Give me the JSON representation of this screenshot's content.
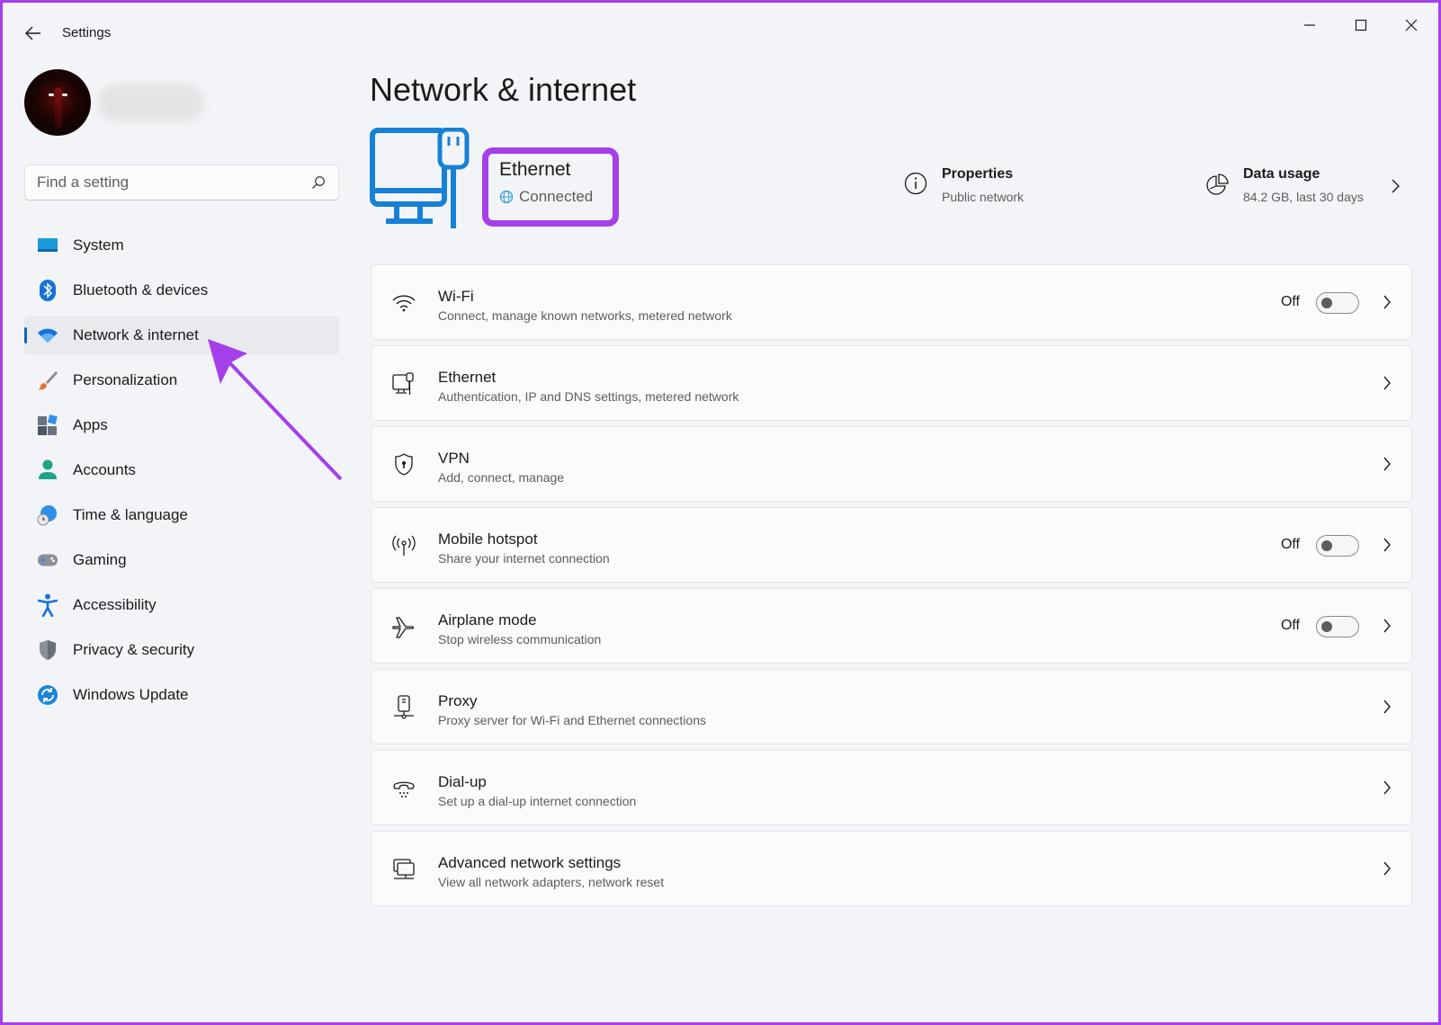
{
  "window": {
    "app_title": "Settings"
  },
  "sidebar": {
    "search_placeholder": "Find a setting",
    "items": [
      {
        "label": "System",
        "icon": "system-icon",
        "active": false
      },
      {
        "label": "Bluetooth & devices",
        "icon": "bluetooth-icon",
        "active": false
      },
      {
        "label": "Network & internet",
        "icon": "wifi-icon",
        "active": true
      },
      {
        "label": "Personalization",
        "icon": "brush-icon",
        "active": false
      },
      {
        "label": "Apps",
        "icon": "apps-icon",
        "active": false
      },
      {
        "label": "Accounts",
        "icon": "person-icon",
        "active": false
      },
      {
        "label": "Time & language",
        "icon": "clock-globe-icon",
        "active": false
      },
      {
        "label": "Gaming",
        "icon": "gamepad-icon",
        "active": false
      },
      {
        "label": "Accessibility",
        "icon": "accessibility-icon",
        "active": false
      },
      {
        "label": "Privacy & security",
        "icon": "shield-icon",
        "active": false
      },
      {
        "label": "Windows Update",
        "icon": "update-icon",
        "active": false
      }
    ]
  },
  "main": {
    "title": "Network & internet",
    "status": {
      "name": "Ethernet",
      "state": "Connected"
    },
    "properties": {
      "title": "Properties",
      "subtitle": "Public network"
    },
    "data_usage": {
      "title": "Data usage",
      "subtitle": "84.2 GB, last 30 days"
    },
    "cards": [
      {
        "title": "Wi-Fi",
        "subtitle": "Connect, manage known networks, metered network",
        "icon": "wifi-icon",
        "toggle": true,
        "state": "Off"
      },
      {
        "title": "Ethernet",
        "subtitle": "Authentication, IP and DNS settings, metered network",
        "icon": "ethernet-icon",
        "toggle": false
      },
      {
        "title": "VPN",
        "subtitle": "Add, connect, manage",
        "icon": "vpn-shield-icon",
        "toggle": false
      },
      {
        "title": "Mobile hotspot",
        "subtitle": "Share your internet connection",
        "icon": "hotspot-icon",
        "toggle": true,
        "state": "Off"
      },
      {
        "title": "Airplane mode",
        "subtitle": "Stop wireless communication",
        "icon": "airplane-icon",
        "toggle": true,
        "state": "Off"
      },
      {
        "title": "Proxy",
        "subtitle": "Proxy server for Wi-Fi and Ethernet connections",
        "icon": "proxy-icon",
        "toggle": false
      },
      {
        "title": "Dial-up",
        "subtitle": "Set up a dial-up internet connection",
        "icon": "dialup-icon",
        "toggle": false
      },
      {
        "title": "Advanced network settings",
        "subtitle": "View all network adapters, network reset",
        "icon": "advanced-network-icon",
        "toggle": false
      }
    ]
  },
  "colors": {
    "accent": "#0f63c9",
    "annotation": "#a53fea"
  }
}
